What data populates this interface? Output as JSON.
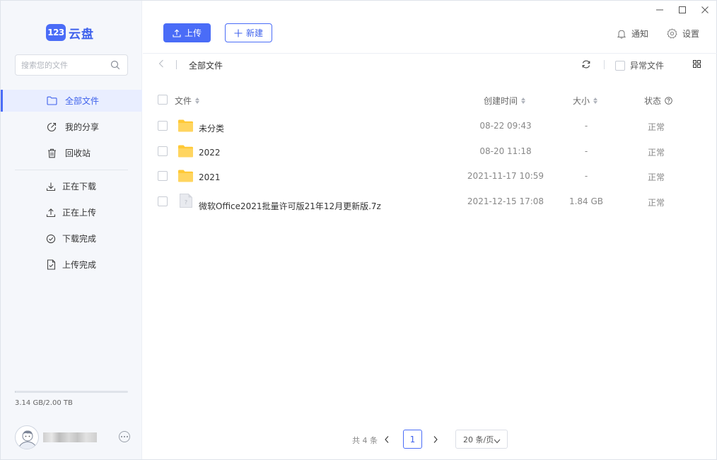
{
  "app": {
    "logo_number": "123",
    "logo_text": "云盘"
  },
  "search": {
    "placeholder": "搜索您的文件"
  },
  "sidebar": {
    "items": [
      {
        "label": "全部文件",
        "icon": "folder-icon",
        "active": true
      },
      {
        "label": "我的分享",
        "icon": "share-icon"
      },
      {
        "label": "回收站",
        "icon": "trash-icon"
      }
    ],
    "transfer_items": [
      {
        "label": "正在下载",
        "icon": "download-icon"
      },
      {
        "label": "正在上传",
        "icon": "upload-icon"
      },
      {
        "label": "下载完成",
        "icon": "check-circle-icon"
      },
      {
        "label": "上传完成",
        "icon": "file-check-icon"
      }
    ],
    "storage": {
      "text": "3.14 GB/2.00 TB",
      "used_fraction": 0.0015
    }
  },
  "header": {
    "upload_label": "上传",
    "new_label": "新建",
    "notify_label": "通知",
    "settings_label": "设置"
  },
  "toolbar": {
    "path": "全部文件",
    "abnormal_label": "异常文件"
  },
  "table": {
    "columns": {
      "name": "文件",
      "time": "创建时间",
      "size": "大小",
      "status": "状态"
    },
    "rows": [
      {
        "name": "未分类",
        "type": "folder",
        "time": "08-22 09:43",
        "size": "-",
        "status": "正常"
      },
      {
        "name": "2022",
        "type": "folder",
        "time": "08-20 11:18",
        "size": "-",
        "status": "正常"
      },
      {
        "name": "2021",
        "type": "folder",
        "time": "2021-11-17 10:59",
        "size": "-",
        "status": "正常"
      },
      {
        "name": "微软Office2021批量许可版21年12月更新版.7z",
        "type": "file",
        "time": "2021-12-15 17:08",
        "size": "1.84 GB",
        "status": "正常"
      }
    ]
  },
  "pagination": {
    "total": "共 4 条",
    "current_page": "1",
    "page_size": "20 条/页"
  },
  "colors": {
    "accent": "#4a6cf7",
    "folder": "#ffc936",
    "sidebar_bg": "#f5f7fb"
  }
}
